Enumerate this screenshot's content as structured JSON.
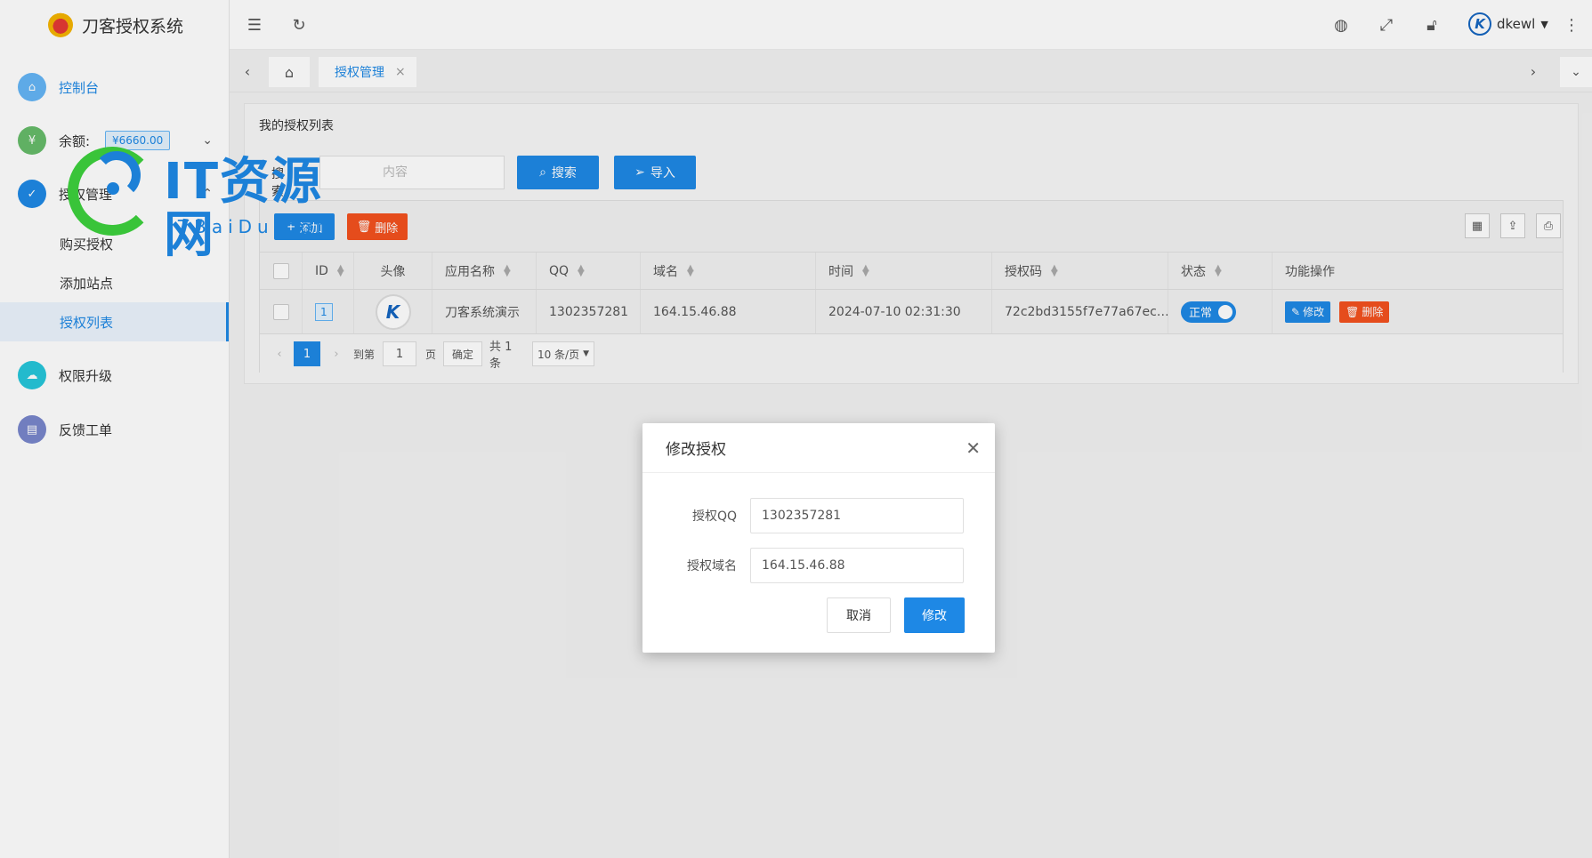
{
  "app": {
    "title": "刀客授权系统"
  },
  "sidebar": {
    "console": "控制台",
    "balance_label": "余额:",
    "balance_value": "¥6660.00",
    "auth_manage": "授权管理",
    "sub_items": [
      "购买授权",
      "添加站点",
      "授权列表"
    ],
    "upgrade": "权限升级",
    "feedback": "反馈工单"
  },
  "watermark": {
    "big": "IT资源网",
    "small": "ITBaiDu.com"
  },
  "header": {
    "username": "dkewl"
  },
  "tabs": {
    "active": "授权管理",
    "close": "×"
  },
  "panel": {
    "title": "我的授权列表",
    "search_label": "搜索",
    "search_placeholder": "内容",
    "search_btn": "搜索",
    "import_btn": "导入",
    "add_btn": "添加",
    "delete_btn": "删除"
  },
  "table": {
    "headers": [
      "ID",
      "头像",
      "应用名称",
      "QQ",
      "域名",
      "时间",
      "授权码",
      "状态",
      "功能操作"
    ],
    "rows": [
      {
        "id": "1",
        "app_name": "刀客系统演示",
        "qq": "1302357281",
        "domain": "164.15.46.88",
        "time": "2024-07-10 02:31:30",
        "code": "72c2bd3155f7e77a67ec…",
        "status": "正常",
        "edit": "修改",
        "del": "删除"
      }
    ]
  },
  "pager": {
    "current": "1",
    "goto": "到第",
    "goto_value": "1",
    "page": "页",
    "confirm": "确定",
    "total": "共 1 条",
    "per_page": "10 条/页"
  },
  "modal": {
    "title": "修改授权",
    "qq_label": "授权QQ",
    "qq_value": "1302357281",
    "domain_label": "授权域名",
    "domain_value": "164.15.46.88",
    "cancel": "取消",
    "submit": "修改"
  },
  "colors": {
    "primary": "#1e88e5",
    "danger": "#f4511e"
  }
}
